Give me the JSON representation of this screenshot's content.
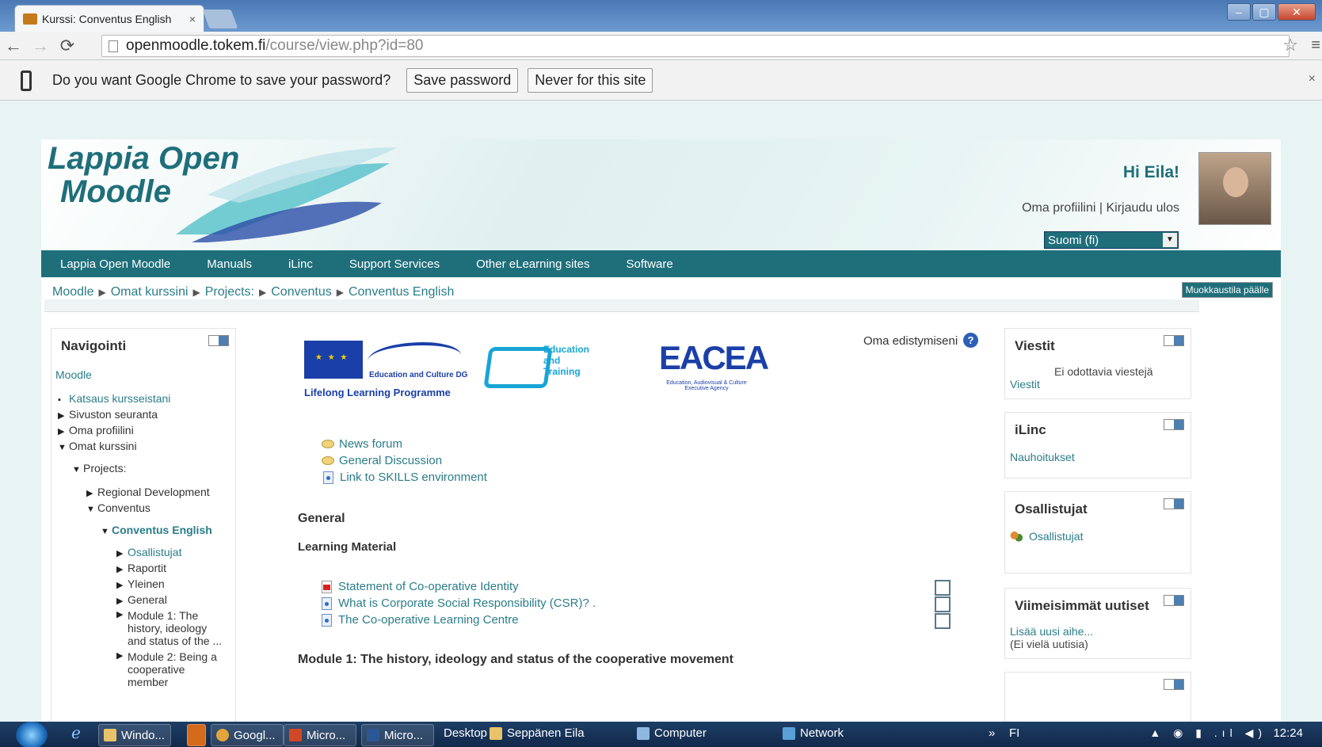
{
  "browser": {
    "tab_title": "Kurssi: Conventus English",
    "tab_close": "×",
    "url_host": "openmoodle.tokem.fi",
    "url_path": "/course/view.php?id=80",
    "infobar": {
      "message": "Do you want Google Chrome to save your password?",
      "save_label": "Save password",
      "never_label": "Never for this site",
      "close": "×"
    },
    "window_buttons": [
      "–",
      "▢",
      "✕"
    ]
  },
  "header": {
    "logo_line1": "Lappia Open",
    "logo_line2": "Moodle",
    "greeting": "Hi Eila!",
    "profile_link": "Oma profiilini",
    "link_separator": "|",
    "logout_link": "Kirjaudu ulos",
    "language": "Suomi (fi)",
    "lang_arrow": "▼"
  },
  "main_nav": [
    "Lappia Open Moodle",
    "Manuals",
    "iLinc",
    "Support Services",
    "Other eLearning sites",
    "Software"
  ],
  "breadcrumb": {
    "items": [
      "Moodle",
      "Omat kurssini",
      "Projects:",
      "Conventus",
      "Conventus English"
    ],
    "separator": "▶"
  },
  "edit_button": "Muokkaustila päälle",
  "navigation": {
    "title": "Navigointi",
    "items": [
      {
        "label": "Moodle",
        "marker": ""
      },
      {
        "label": "Katsaus kursseistani",
        "marker": "▪"
      },
      {
        "label": "Sivuston seuranta",
        "marker": "▶"
      },
      {
        "label": "Oma profiilini",
        "marker": "▶"
      },
      {
        "label": "Omat kurssini",
        "marker": "▼"
      },
      {
        "label": "Projects:",
        "marker": "▼"
      },
      {
        "label": "Regional Development",
        "marker": "▶"
      },
      {
        "label": "Conventus",
        "marker": "▼"
      },
      {
        "label": "Conventus English",
        "marker": "▼"
      },
      {
        "label": "Osallistujat",
        "marker": "▶"
      },
      {
        "label": "Raportit",
        "marker": "▶"
      },
      {
        "label": "Yleinen",
        "marker": "▶"
      },
      {
        "label": "General",
        "marker": "▶"
      },
      {
        "label": "Module 1: The history, ideology and status of the ...",
        "marker": "▶"
      },
      {
        "label": "Module 2: Being a cooperative member",
        "marker": "▶"
      }
    ]
  },
  "logos": {
    "llp_dg": "Education and Culture DG",
    "llp_title": "Lifelong Learning Programme",
    "edu_text": "Education and Training",
    "eacea": "EACEA",
    "eacea_sub": "Education, Audiovisual & Culture Executive Agency"
  },
  "course": {
    "progress_label": "Oma edistymiseni",
    "help_icon": "?",
    "top_activities": [
      "News forum",
      "General Discussion",
      "Link to SKILLS environment"
    ],
    "section_general": "General",
    "section_learning_material": "Learning Material",
    "material_items": [
      "Statement of Co-operative Identity",
      "What is Corporate Social Responsibility (CSR)? .",
      "The Co-operative Learning Centre"
    ],
    "module1_title": "Module 1: The history, ideology and status of the cooperative movement"
  },
  "right_blocks": {
    "viestit": {
      "title": "Viestit",
      "status": "Ei odottavia viestejä",
      "link": "Viestit"
    },
    "ilinc": {
      "title": "iLinc",
      "link": "Nauhoitukset"
    },
    "osallistujat": {
      "title": "Osallistujat",
      "link": "Osallistujat"
    },
    "uutiset": {
      "title": "Viimeisimmät uutiset",
      "link": "Lisää uusi aihe...",
      "empty": "(Ei vielä uutisia)"
    }
  },
  "taskbar": {
    "tasks": [
      "Windo...",
      "Googl...",
      "Micro...",
      "Micro..."
    ],
    "desktop": "Desktop",
    "user": "Seppänen Eila",
    "computer": "Computer",
    "network": "Network",
    "lang": "FI",
    "overflow": "»",
    "tray": "▲ ◉ ▮ .ıl ◀)",
    "clock": "12:24"
  },
  "colors": {
    "teal": "#1f6f7a",
    "link": "#2a7d89",
    "taskbar": "#12294a"
  }
}
